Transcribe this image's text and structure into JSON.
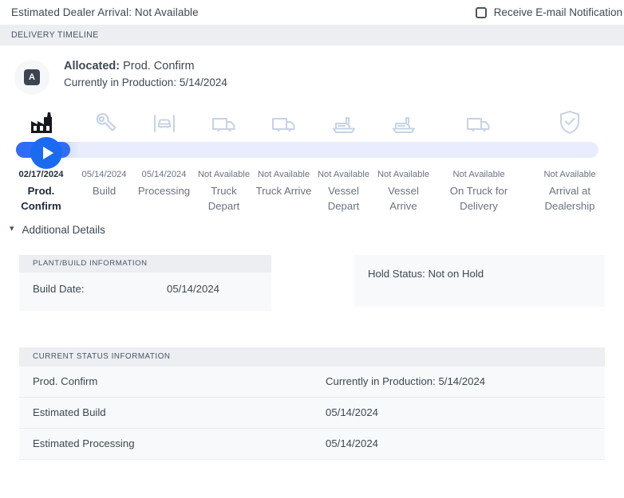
{
  "topbar": {
    "estimated_arrival": "Estimated Dealer Arrival: Not Available",
    "notification_label": "Receive E-mail Notification",
    "checkbox_checked": false
  },
  "section": {
    "delivery_timeline_title": "DELIVERY TIMELINE"
  },
  "allocated": {
    "avatar_letter": "A",
    "status_label": "Allocated:",
    "status_value": "Prod. Confirm",
    "production_line": "Currently in Production: 5/14/2024"
  },
  "timeline": {
    "progress_percent": 8,
    "accent_color": "#1a6bf0",
    "track_color": "#e8edfd",
    "steps": [
      {
        "icon": "factory-icon",
        "date": "02/17/2024",
        "name": "Prod. Confirm",
        "active": true
      },
      {
        "icon": "wrench-icon",
        "date": "05/14/2024",
        "name": "Build",
        "active": false
      },
      {
        "icon": "car-inspection-icon",
        "date": "05/14/2024",
        "name": "Processing",
        "active": false
      },
      {
        "icon": "truck-depart-icon",
        "date": "Not Available",
        "name": "Truck Depart",
        "active": false
      },
      {
        "icon": "truck-arrive-icon",
        "date": "Not Available",
        "name": "Truck Arrive",
        "active": false
      },
      {
        "icon": "vessel-depart-icon",
        "date": "Not Available",
        "name": "Vessel Depart",
        "active": false
      },
      {
        "icon": "vessel-arrive-icon",
        "date": "Not Available",
        "name": "Vessel Arrive",
        "active": false
      },
      {
        "icon": "delivery-truck-icon",
        "date": "Not Available",
        "name": "On Truck for Delivery",
        "active": false
      },
      {
        "icon": "shield-check-icon",
        "date": "Not Available",
        "name": "Arrival at Dealership",
        "active": false
      }
    ]
  },
  "additional_details": {
    "label": "Additional Details",
    "chevron": "chevron-down-icon"
  },
  "plant_build": {
    "header": "PLANT/BUILD INFORMATION",
    "rows": [
      {
        "key": "Build Date:",
        "value": "05/14/2024"
      }
    ]
  },
  "hold": {
    "text": "Hold Status: Not on Hold"
  },
  "current_status": {
    "header": "CURRENT STATUS INFORMATION",
    "rows": [
      {
        "key": "Prod. Confirm",
        "value": "Currently in Production: 5/14/2024"
      },
      {
        "key": "Estimated Build",
        "value": "05/14/2024"
      },
      {
        "key": "Estimated Processing",
        "value": "05/14/2024"
      }
    ]
  }
}
